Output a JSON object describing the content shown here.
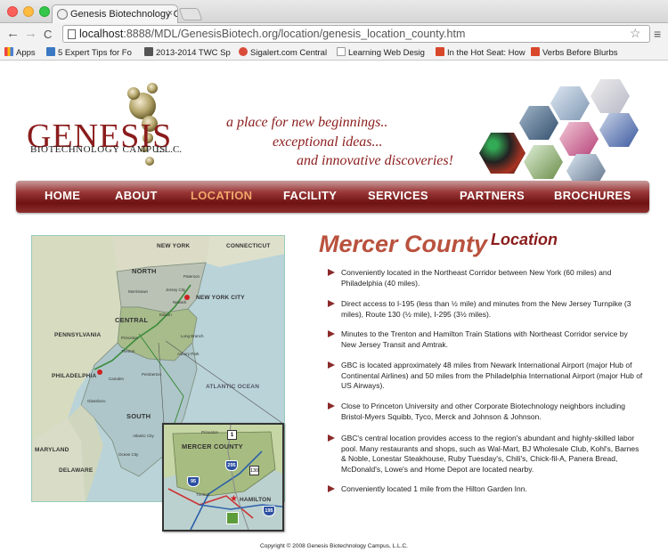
{
  "browser": {
    "tab_title": "Genesis Biotechnology Ca",
    "tab_close": "×",
    "url_host": "localhost",
    "url_rest": ":8888/MDL/GenesisBiotech.org/location/genesis_location_county.htm",
    "back": "←",
    "forward": "→",
    "reload": "C",
    "star": "☆",
    "menu": "≡",
    "bookmarks": [
      {
        "label": "Apps",
        "color": "#4a7fd4"
      },
      {
        "label": "5 Expert Tips for Fo",
        "color": "#3b78c4"
      },
      {
        "label": "2013-2014 TWC Sp",
        "color": "#555555"
      },
      {
        "label": "Sigalert.com Central",
        "color": "#d94c3a"
      },
      {
        "label": "Learning Web Desig",
        "color": "#dddddd"
      },
      {
        "label": "In the Hot Seat: How",
        "color": "#d9472b"
      },
      {
        "label": "Verbs Before Blurbs",
        "color": "#d9472b"
      }
    ]
  },
  "header": {
    "logo_text": "GENESIS",
    "logo_sub": "BIOTECHNOLOGY CAMPUS",
    "logo_llc": "L.L.C.",
    "tagline": [
      "a place for new beginnings..",
      "exceptional ideas...",
      "and innovative discoveries!"
    ]
  },
  "nav": [
    "HOME",
    "ABOUT",
    "LOCATION",
    "FACILITY",
    "SERVICES",
    "PARTNERS",
    "BROCHURES"
  ],
  "nav_active": "LOCATION",
  "map": {
    "regions": [
      "NORTH",
      "CENTRAL",
      "SOUTH"
    ],
    "states": [
      "NEW YORK",
      "CONNECTICUT",
      "PENNSYLVANIA",
      "MARYLAND",
      "DELAWARE",
      "ATLANTIC OCEAN"
    ],
    "cities": [
      "NEW YORK CITY",
      "PHILADELPHIA",
      "HAMILTON"
    ],
    "towns": [
      "Paterson",
      "Jersey City",
      "Newark",
      "Morristown",
      "Edison",
      "Princeton",
      "Trenton",
      "Long Branch",
      "Asbury Park",
      "Camden",
      "Pemberton",
      "Glassboro",
      "Atlantic City",
      "Ocean City"
    ],
    "inset_title": "MERCER COUNTY",
    "inset_towns": [
      "Princeton",
      "Trenton"
    ],
    "highways": [
      "95",
      "295",
      "195",
      "130",
      "1"
    ]
  },
  "content": {
    "title_county": "Mercer County",
    "title_location": "Location",
    "bullets": [
      "Conveniently located in the Northeast Corridor between New York (60 miles) and Philadelphia (40 miles).",
      "Direct access to I-195 (less than ½ mile) and minutes from the New Jersey Turnpike (3 miles), Route 130 (½ mile), I-295 (3½ miles).",
      "Minutes to the Trenton and Hamilton Train Stations with Northeast Corridor service by New Jersey Transit and Amtrak.",
      "GBC is located approximately 48 miles from Newark International Airport (major Hub of Continental Airlines) and 50 miles from the Philadelphia International Airport (major Hub of US Airways).",
      "Close to Princeton University and other Corporate Biotechnology neighbors including Bristol-Myers Squibb, Tyco, Merck and Johnson & Johnson.",
      "GBC's central location provides access to the region's abundant and highly-skilled labor pool. Many restaurants and shops, such as Wal-Mart, BJ Wholesale Club, Kohl's, Barnes & Noble, Lonestar Steakhouse, Ruby Tuesday's, Chili's, Chick-fil-A, Panera Bread, McDonald's, Lowe's and Home Depot are located nearby.",
      "Conveniently located 1 mile from the Hilton Garden Inn."
    ]
  },
  "footer": {
    "copyright": "Copyright © 2008 Genesis Biotechnology Campus, L.L.C."
  }
}
